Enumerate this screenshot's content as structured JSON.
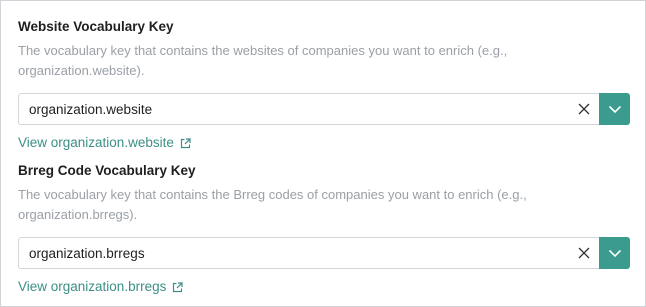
{
  "fields": [
    {
      "title": "Website Vocabulary Key",
      "description": "The vocabulary key that contains the websites of companies you want to enrich (e.g., organization.website).",
      "value": "organization.website",
      "link_text": "View organization.website",
      "clear_icon": "close-icon",
      "dropdown_icon": "chevron-down-icon",
      "link_icon": "external-link-icon"
    },
    {
      "title": "Brreg Code Vocabulary Key",
      "description": "The vocabulary key that contains the Brreg codes of companies you want to enrich (e.g., organization.brregs).",
      "value": "organization.brregs",
      "link_text": "View organization.brregs",
      "clear_icon": "close-icon",
      "dropdown_icon": "chevron-down-icon",
      "link_icon": "external-link-icon"
    }
  ],
  "colors": {
    "accent": "#3b9b8f",
    "link": "#3b8f86",
    "description": "#9aa0a6",
    "border": "#d3d6da"
  }
}
